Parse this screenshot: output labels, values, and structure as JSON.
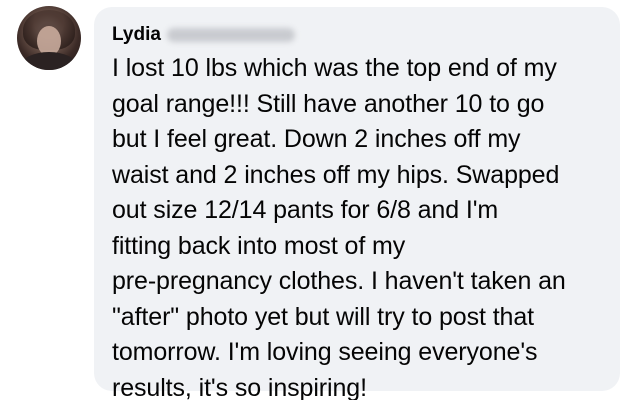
{
  "comment": {
    "author": "Lydia",
    "author_surname_redacted": true,
    "text": "I lost 10 lbs which was the top end of my\ngoal range!!! Still have another 10 to go\nbut I feel great. Down 2 inches off my\nwaist and 2 inches off my hips. Swapped\nout size 12/14 pants for 6/8 and I'm\nfitting back into most of my\npre-pregnancy clothes. I haven't taken an\n\"after\" photo yet but will try to post that\ntomorrow. I'm loving seeing everyone's\nresults, it's so inspiring!"
  },
  "colors": {
    "bubble_background": "#f0f2f5",
    "text": "#050505",
    "page_background": "#ffffff"
  }
}
